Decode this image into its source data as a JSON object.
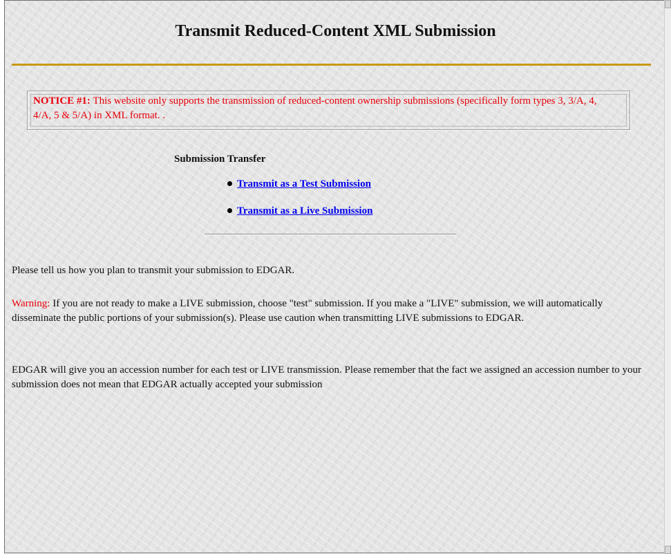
{
  "page": {
    "title": "Transmit Reduced-Content XML Submission"
  },
  "notice": {
    "label": "NOTICE #1:",
    "text": " This website only supports the transmission of reduced-content ownership submissions (specifically form types 3, 3/A, 4, 4/A, 5 & 5/A) in XML format. ."
  },
  "transfer": {
    "heading": "Submission Transfer",
    "links": [
      {
        "label": "Transmit as a Test Submission"
      },
      {
        "label": "Transmit as a Live Submission"
      }
    ]
  },
  "content": {
    "intro": "Please tell us how you plan to transmit your submission to EDGAR.",
    "warning_label": "Warning:",
    "warning_text": " If you are not ready to make a LIVE submission, choose \"test\" submission. If you make a \"LIVE\" submission, we will automatically disseminate the public portions of your submission(s). Please use caution when transmitting LIVE submissions to EDGAR.",
    "accession_text": "EDGAR will give you an accession number for each test or LIVE transmission. Please remember that the fact we assigned an accession number to your submission does not mean that EDGAR actually accepted your submission"
  },
  "colors": {
    "title_rule": "#c79a12",
    "notice_text": "#e8000b",
    "link": "#0000ee"
  }
}
